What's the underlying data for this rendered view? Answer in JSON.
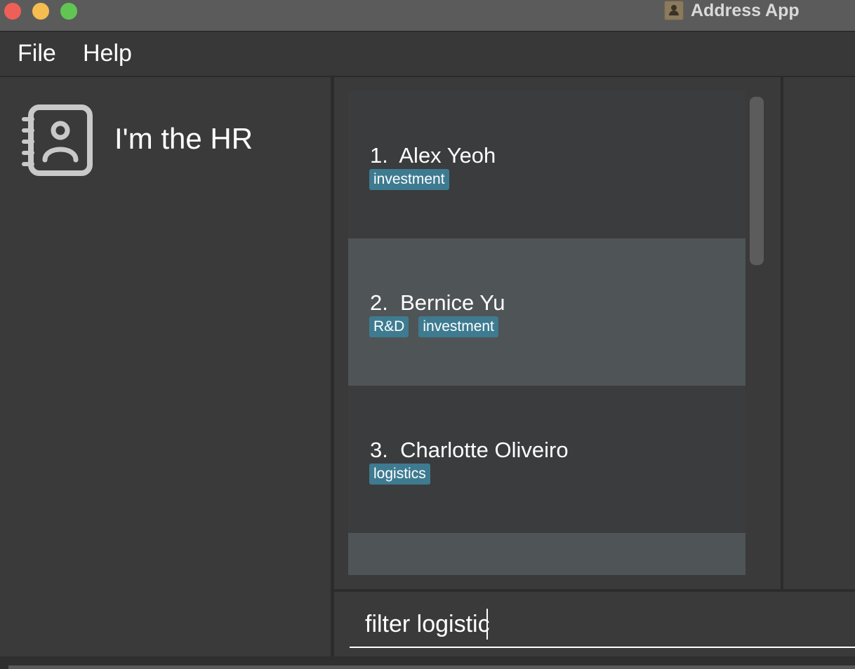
{
  "window": {
    "title": "Address App"
  },
  "menu": {
    "file": "File",
    "help": "Help"
  },
  "sidebar": {
    "app_name": "I'm the HR",
    "icon": "address-book-icon"
  },
  "persons": [
    {
      "index": "1.",
      "name": "Alex Yeoh",
      "tags": [
        "investment"
      ]
    },
    {
      "index": "2.",
      "name": "Bernice Yu",
      "tags": [
        "R&D",
        "investment"
      ]
    },
    {
      "index": "3.",
      "name": "Charlotte Oliveiro",
      "tags": [
        "logistics"
      ]
    }
  ],
  "command": {
    "value": "filter logistic"
  },
  "colors": {
    "tag": "#3e7b91",
    "background": "#3a3a3a",
    "card_dark": "#3b3c3e",
    "card_light": "#4f5456"
  }
}
